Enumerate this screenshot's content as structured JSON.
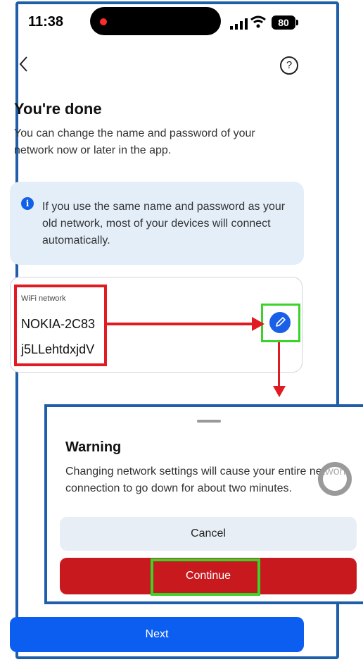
{
  "status_bar": {
    "time": "11:38",
    "battery": "80"
  },
  "icons": {
    "back": "chevron-left-icon",
    "help": "question-icon",
    "info": "info-icon",
    "edit": "pencil-icon"
  },
  "page": {
    "help_glyph": "?",
    "title": "You're done",
    "subtitle": "You can change the name and password of your network now or later in the app."
  },
  "info_box": {
    "icon_glyph": "i",
    "text": "If you use the same name and password as your old network, most of your devices will connect automatically."
  },
  "network": {
    "label": "WiFi network",
    "name": "NOKIA-2C83",
    "password": "j5LLehtdxjdV"
  },
  "warning_sheet": {
    "title": "Warning",
    "text": "Changing network settings will cause your entire network connection to go down for about two minutes.",
    "cancel_label": "Cancel",
    "continue_label": "Continue"
  },
  "footer": {
    "next_label": "Next"
  },
  "colors": {
    "primary": "#0b5ef0",
    "continue": "#c8191f",
    "info_bg": "#e4eef9",
    "highlight_red": "#e01b22",
    "highlight_green": "#3bd32a",
    "frame": "#1f5ea8"
  }
}
